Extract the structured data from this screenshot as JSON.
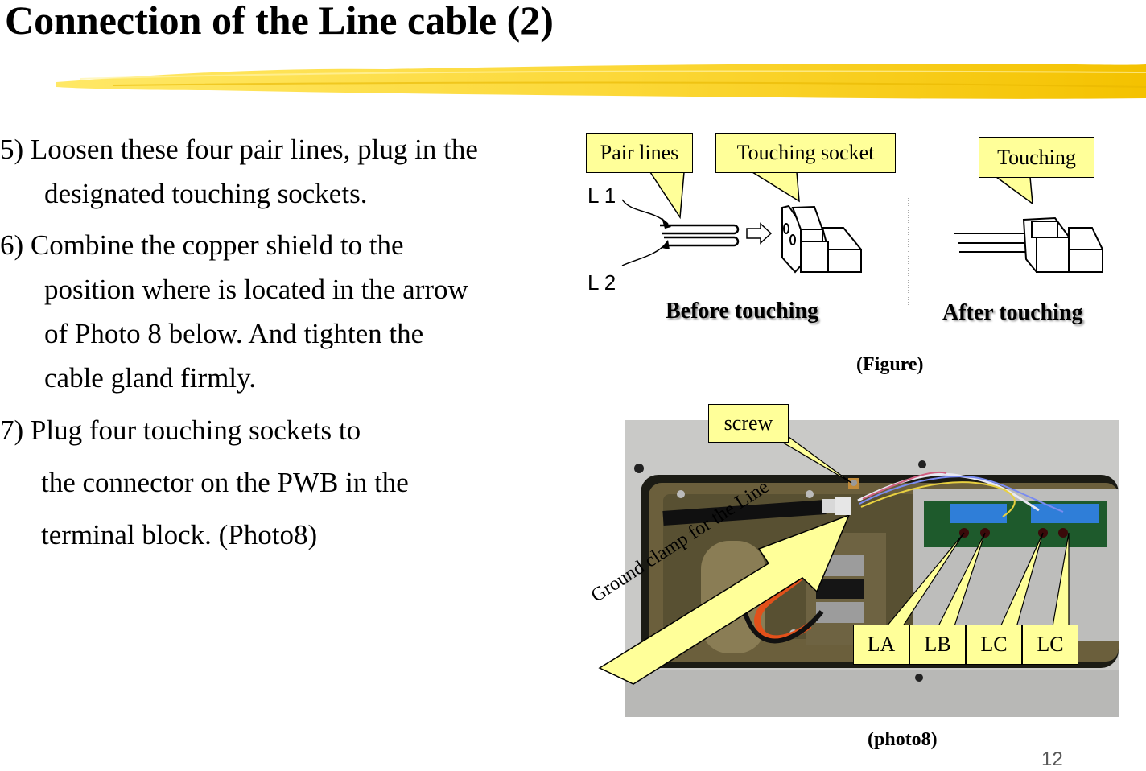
{
  "slide": {
    "title": "Connection of the Line cable (2)",
    "page_number": "12",
    "accent_yellow": "#ffff99",
    "brush_color": "#f5c400"
  },
  "instructions": {
    "step5": {
      "line1": "5) Loosen these four pair lines, plug in the",
      "line2": "designated touching sockets."
    },
    "step6": {
      "line1": "6) Combine the copper shield to the",
      "line2": "position where is located in the arrow",
      "line3": "of Photo 8 below. And tighten the",
      "line4": "cable gland firmly."
    },
    "step7": {
      "line1": "7) Plug four touching sockets to",
      "line2": "the connector on the PWB in the",
      "line3": "terminal block. (Photo8)"
    }
  },
  "figure": {
    "callouts": {
      "pair_lines": "Pair lines",
      "touching_socket": "Touching socket",
      "touching": "Touching"
    },
    "wire_labels": {
      "l1": "L 1",
      "l2": "L 2"
    },
    "before_caption": "Before touching",
    "after_caption": "After touching",
    "figure_caption": "(Figure)"
  },
  "photo": {
    "callouts": {
      "screw": "screw",
      "ground_clamp": "Ground clamp for the Line",
      "connectors": [
        "LA",
        "LB",
        "LC",
        "LC"
      ]
    },
    "caption": "(photo8)"
  }
}
